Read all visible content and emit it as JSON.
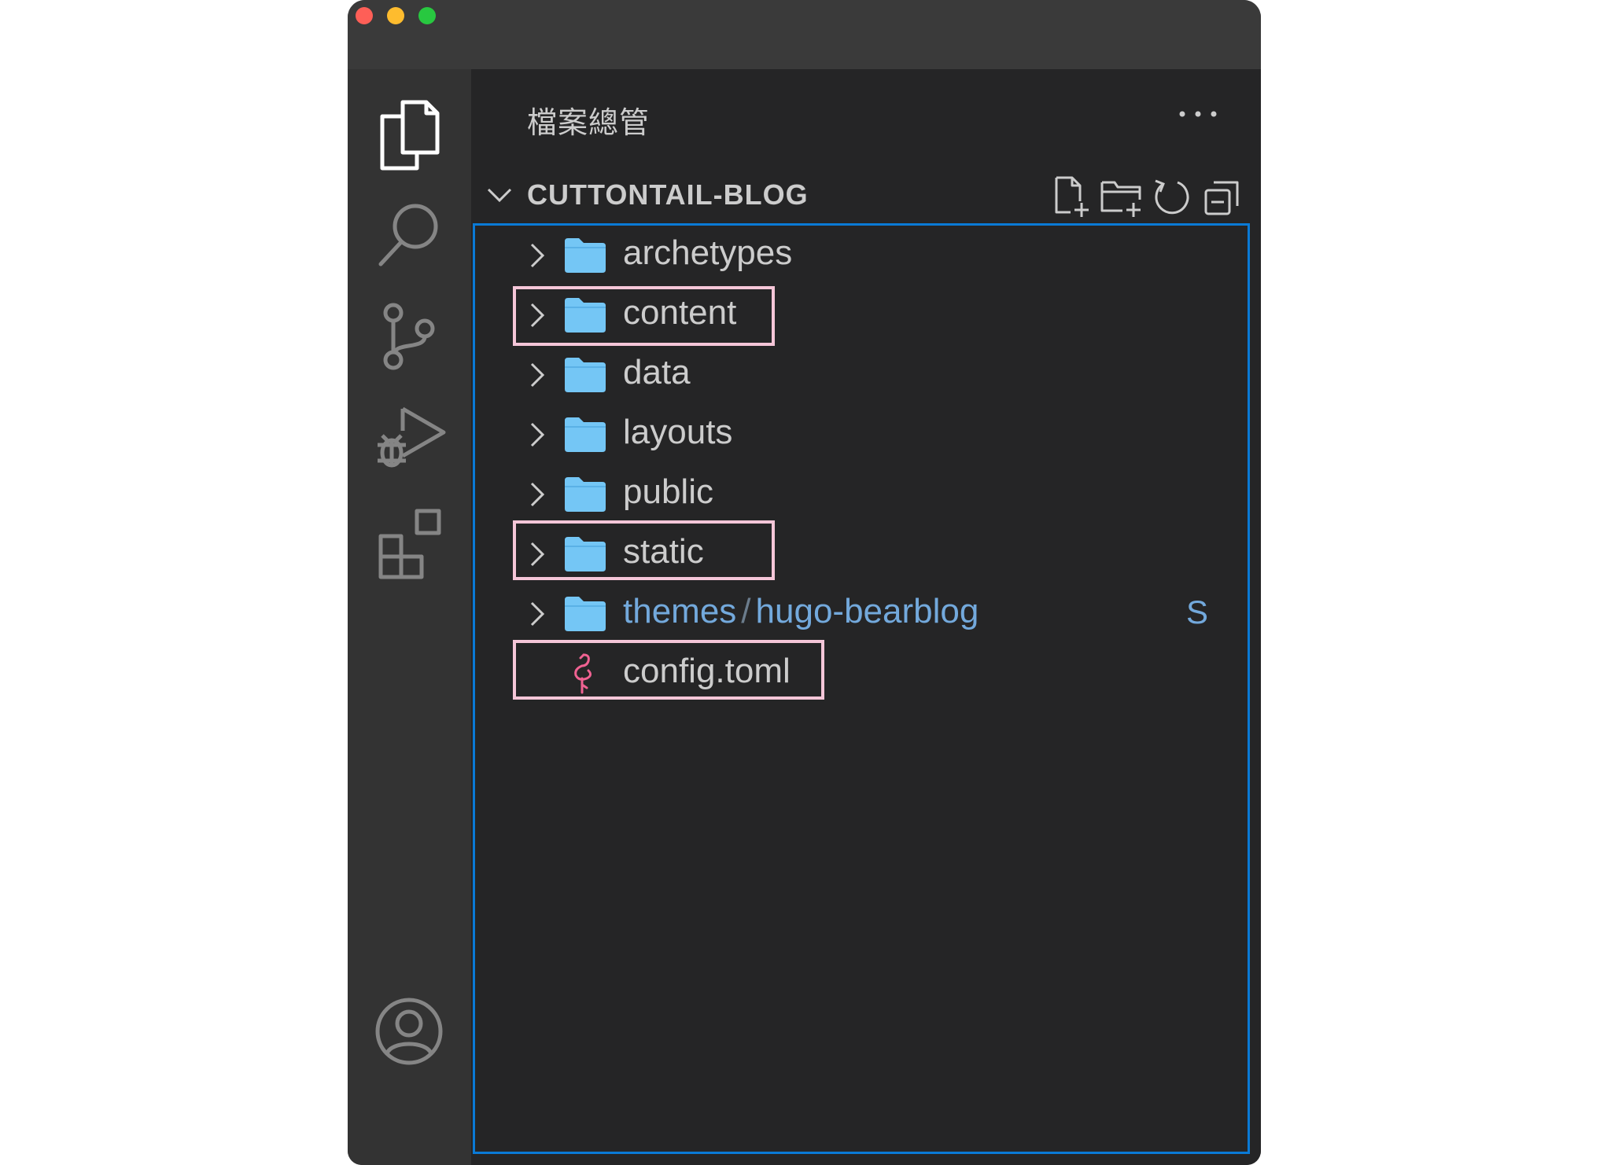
{
  "window": {
    "traffic_lights": [
      "close",
      "minimize",
      "maximize"
    ]
  },
  "activity_bar": {
    "items": [
      {
        "name": "explorer",
        "icon": "files-icon",
        "active": true
      },
      {
        "name": "search",
        "icon": "search-icon",
        "active": false
      },
      {
        "name": "source-control",
        "icon": "source-control-icon",
        "active": false
      },
      {
        "name": "run-and-debug",
        "icon": "run-debug-icon",
        "active": false
      },
      {
        "name": "extensions",
        "icon": "extensions-icon",
        "active": false
      },
      {
        "name": "accounts",
        "icon": "account-icon",
        "active": false
      }
    ]
  },
  "sidebar": {
    "title": "檔案總管",
    "more_icon": "more-actions-icon",
    "section": {
      "label": "CUTTONTAIL-BLOG",
      "expanded": true,
      "actions": [
        {
          "name": "new-file",
          "icon": "new-file-icon"
        },
        {
          "name": "new-folder",
          "icon": "new-folder-icon"
        },
        {
          "name": "refresh",
          "icon": "refresh-icon"
        },
        {
          "name": "collapse-all",
          "icon": "collapse-all-icon"
        }
      ]
    },
    "tree": [
      {
        "label": "archetypes",
        "type": "folder",
        "highlighted": false
      },
      {
        "label": "content",
        "type": "folder",
        "highlighted": true
      },
      {
        "label": "data",
        "type": "folder",
        "highlighted": false
      },
      {
        "label": "layouts",
        "type": "folder",
        "highlighted": false
      },
      {
        "label": "public",
        "type": "folder",
        "highlighted": false
      },
      {
        "label": "static",
        "type": "folder",
        "highlighted": true
      },
      {
        "label": "themes",
        "label2": "hugo-bearblog",
        "separator": "/",
        "type": "folder",
        "git_status": "S",
        "highlighted": false
      },
      {
        "label": "config.toml",
        "type": "file",
        "icon": "flamingo-toml-icon",
        "highlighted": true
      }
    ]
  },
  "colors": {
    "accent_border": "#0a7ad6",
    "highlight_box": "#f5c6d8",
    "folder": "#74c6f5",
    "git_text": "#73a9dc"
  }
}
